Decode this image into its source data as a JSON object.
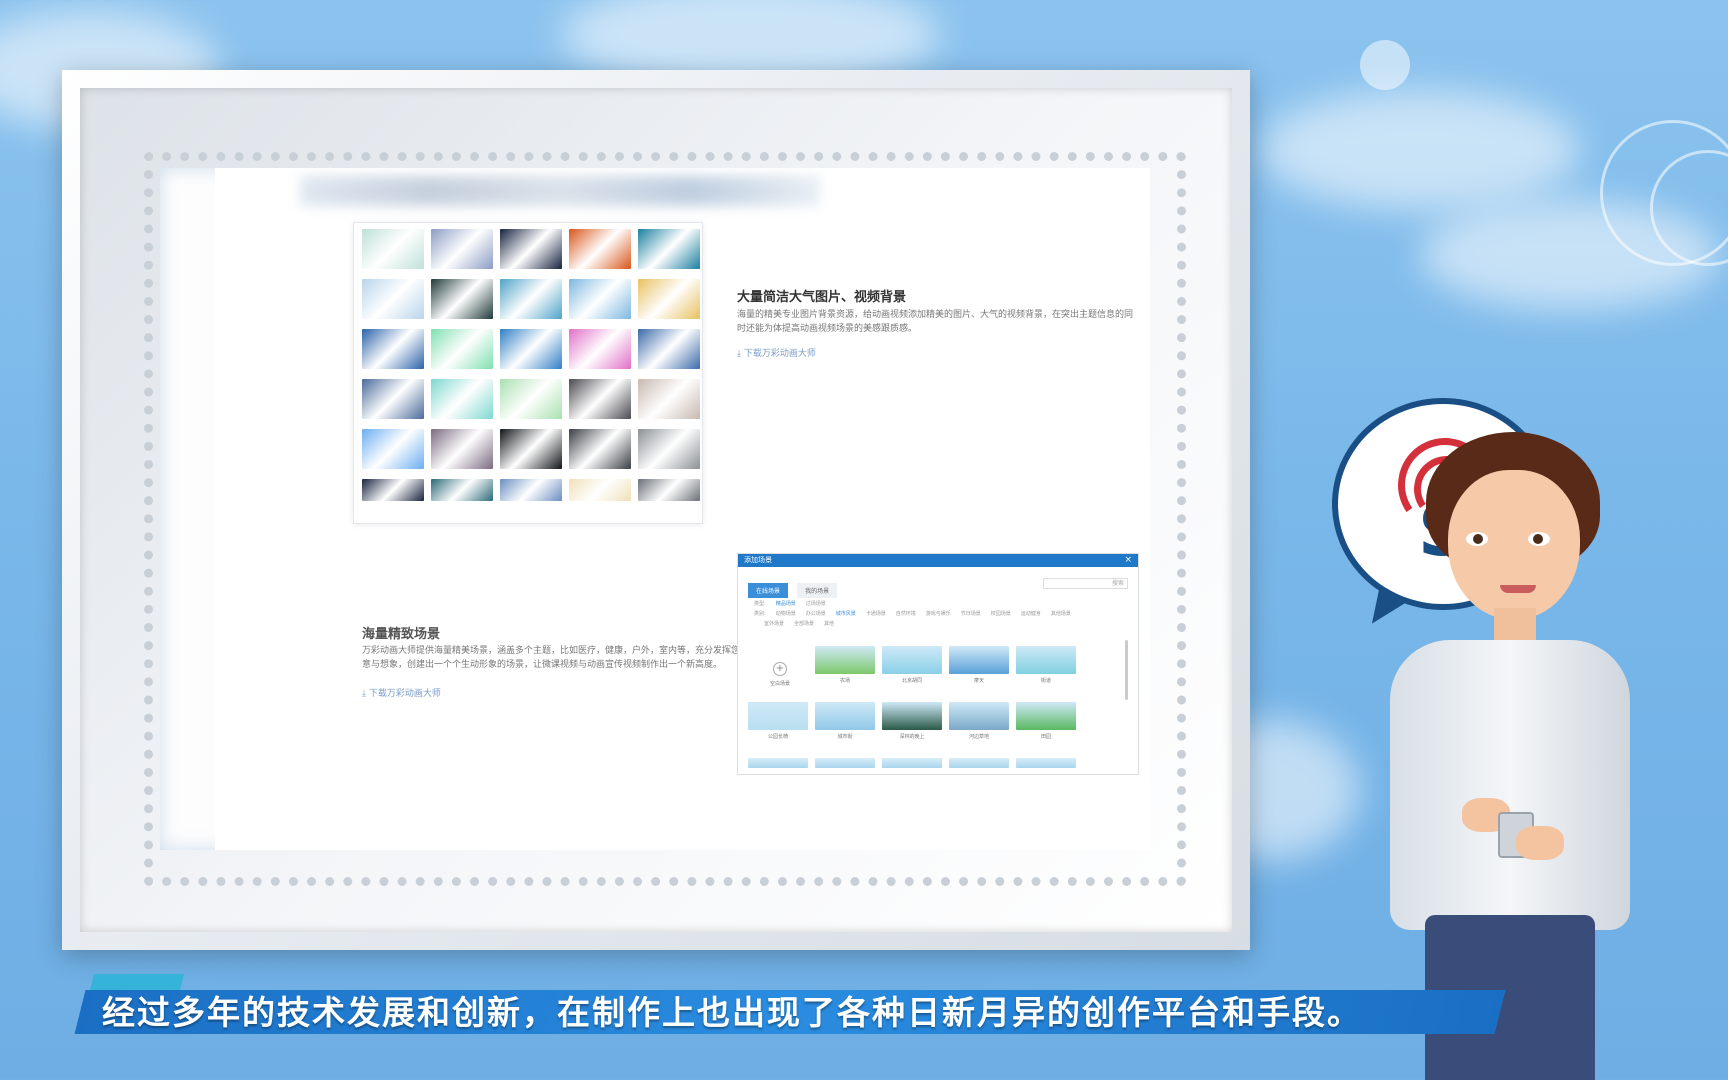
{
  "background_colors": {
    "sky_top": "#8cc3ee",
    "sky_bottom": "#6eaee4",
    "brand_blue": "#1f78c8",
    "speech_red": "#d3303b"
  },
  "section1": {
    "title": "大量简洁大气图片、视频背景",
    "desc": "海量的精美专业图片背景资源，给动画视频添加精美的图片、大气的视频背景，在突出主题信息的同时还能为体提高动画视频场景的美感跟质感。",
    "download": "下载万彩动画大师",
    "icon": "download-icon"
  },
  "section2": {
    "title": "海量精致场景",
    "desc": "万彩动画大师提供海量精美场景，涵盖多个主题，比如医疗，健康，户外，室内等，充分发挥您的创意与想象，创建出一个个生动形象的场景，让微课视频与动画宣传视频制作出一个新高度。",
    "download": "下载万彩动画大师",
    "icon": "download-icon"
  },
  "thumbnails": [
    "#bfe0d8",
    "#8b9cc4",
    "#16233f",
    "#d9561a",
    "#1a7fa0",
    "#b8d4ea",
    "#1f3a3a",
    "#4fa3c8",
    "#7cb8e0",
    "#e8c060",
    "#2a62a8",
    "#7fe0b0",
    "#2f7fc4",
    "#e070c8",
    "#3a6aa8",
    "#4a6a9a",
    "#7fd8d0",
    "#a8e0b0",
    "#4a4a50",
    "#c8b8b0",
    "#6aaef0",
    "#7a6a80",
    "#111418",
    "#3a3e44",
    "#8a9094",
    "#1a2440",
    "#2a6a78",
    "#6a8ec0",
    "#f0e0b8",
    "#6a7078"
  ],
  "dialog": {
    "title": "添加场景",
    "close": "×",
    "tabs": [
      "在线场景",
      "我的场景"
    ],
    "search_placeholder": "搜索",
    "filters": {
      "row1": [
        "类型:",
        "精品场景",
        "过场场景"
      ],
      "row2": [
        "类别:",
        "动物场景",
        "办公场景",
        "城市风景",
        "卡通场景",
        "自然环境",
        "游戏与娱乐",
        "节日场景",
        "校园场景",
        "运动健身",
        "其他场景"
      ],
      "row3": [
        "",
        "室外场景",
        "全部场景",
        "其他"
      ]
    },
    "add_label": "空白场景",
    "scenes": [
      {
        "label": "农场",
        "color": "#7cc86a"
      },
      {
        "label": "北京胡同",
        "color": "#8ad0e8"
      },
      {
        "label": "摩天",
        "color": "#5aa0d8"
      },
      {
        "label": "街道",
        "color": "#7fd0e0"
      },
      {
        "label": "公园长椅",
        "color": "#b8dff0"
      },
      {
        "label": "城市街",
        "color": "#8fc8e8"
      },
      {
        "label": "深林的晚上",
        "color": "#2a5a48"
      },
      {
        "label": "河边草地",
        "color": "#7aa8c8"
      },
      {
        "label": "田园",
        "color": "#5ab860"
      }
    ]
  },
  "speech_bubble": {
    "letter": "S"
  },
  "subtitle": "经过多年的技术发展和创新，在制作上也出现了各种日新月异的创作平台和手段。"
}
